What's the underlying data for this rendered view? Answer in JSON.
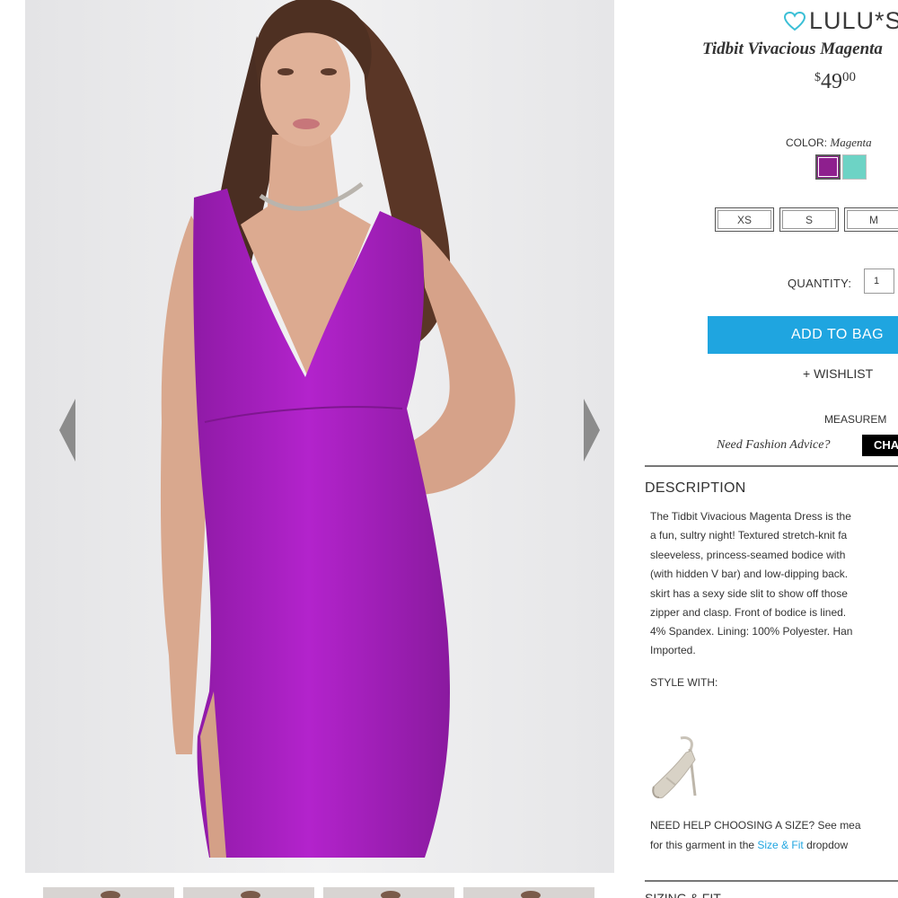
{
  "colors": {
    "accent": "#1fa5e0",
    "dress": "#a51ebe",
    "swatch_magenta": "#8e1f8e",
    "swatch_mint": "#6dd3c5",
    "chat_bg": "#000000"
  },
  "gallery": {
    "prev_icon": "chevron-left-icon",
    "next_icon": "chevron-right-icon",
    "thumbnail_count": 4
  },
  "product": {
    "brand": "LULU*S",
    "brand_icon": "heart-icon",
    "name": "Tidbit Vivacious Magenta",
    "price_currency": "$",
    "price_whole": "49",
    "price_cents": "00",
    "color_label": "COLOR:",
    "color_value": "Magenta",
    "swatches": [
      "Magenta",
      "Mint"
    ],
    "sizes": [
      "XS",
      "S",
      "M"
    ],
    "quantity_label": "QUANTITY:",
    "quantity_value": "1",
    "add_to_bag": "ADD TO BAG",
    "wishlist": "+ WISHLIST",
    "measurements": "MEASUREM",
    "advice_text": "Need Fashion Advice?",
    "chat_label": "CHA"
  },
  "description": {
    "title": "DESCRIPTION",
    "lines": [
      "The Tidbit Vivacious Magenta Dress is the",
      "a fun, sultry night! Textured stretch-knit fa",
      "sleeveless, princess-seamed bodice with",
      "(with hidden V bar) and low-dipping back.",
      "skirt has a sexy side slit to show off those",
      "zipper and clasp. Front of bodice is lined.",
      "4% Spandex. Lining: 100% Polyester. Han",
      "Imported."
    ],
    "style_with": "STYLE WITH:",
    "help_line1": "NEED HELP CHOOSING A SIZE? See mea",
    "help_line2_pre": "for this garment in the ",
    "help_link": "Size & Fit",
    "help_line2_post": " dropdow",
    "sizing_title": "SIZING & FIT"
  }
}
